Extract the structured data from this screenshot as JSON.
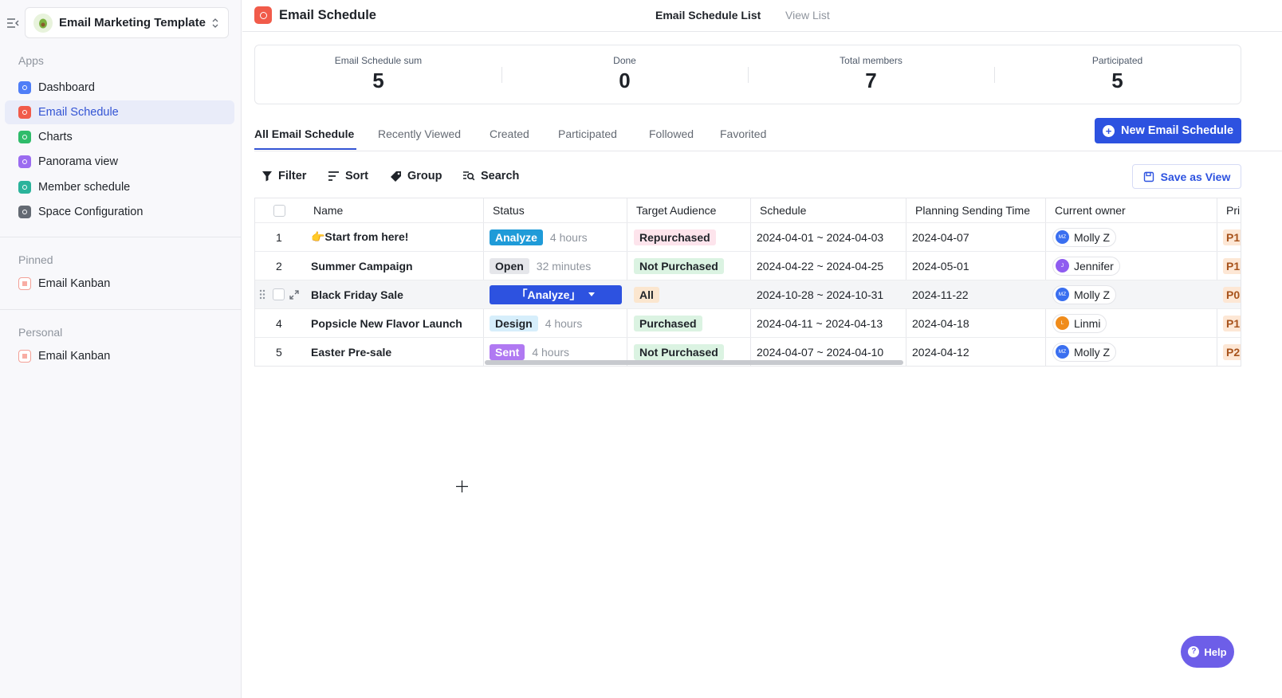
{
  "sidebar": {
    "workspace_name": "Email Marketing Template",
    "sections": {
      "apps": "Apps",
      "pinned": "Pinned",
      "personal": "Personal"
    },
    "apps": [
      {
        "label": "Dashboard",
        "color": "#4f7ef7"
      },
      {
        "label": "Email Schedule",
        "color": "#f15b4a",
        "active": true
      },
      {
        "label": "Charts",
        "color": "#2fbc6a"
      },
      {
        "label": "Panorama view",
        "color": "#9b6cf0"
      },
      {
        "label": "Member schedule",
        "color": "#2bb39b"
      },
      {
        "label": "Space Configuration",
        "color": "#646a73"
      }
    ],
    "pinned": [
      {
        "label": "Email Kanban"
      }
    ],
    "personal": [
      {
        "label": "Email Kanban"
      }
    ]
  },
  "header": {
    "title": "Email Schedule",
    "tabs": [
      "Email Schedule List",
      "View List"
    ]
  },
  "stats": [
    {
      "label": "Email Schedule sum",
      "value": "5"
    },
    {
      "label": "Done",
      "value": "0"
    },
    {
      "label": "Total members",
      "value": "7"
    },
    {
      "label": "Participated",
      "value": "5"
    }
  ],
  "view_tabs": [
    "All Email Schedule",
    "Recently Viewed",
    "Created",
    "Participated",
    "Followed",
    "Favorited"
  ],
  "new_button": "New Email Schedule",
  "toolbar": {
    "filter": "Filter",
    "sort": "Sort",
    "group": "Group",
    "search": "Search",
    "save_view": "Save as View"
  },
  "table": {
    "columns": [
      "Name",
      "Status",
      "Target Audience",
      "Schedule",
      "Planning Sending Time",
      "Current owner",
      "Pri"
    ],
    "rows": [
      {
        "num": "1",
        "name": "👉Start from here!",
        "status": "Analyze",
        "status_color": "#1f9bd8",
        "duration": "4 hours",
        "audience": "Repurchased",
        "audience_bg": "#fde4ec",
        "schedule": "2024-04-01 ~ 2024-04-03",
        "send": "2024-04-07",
        "owner": "Molly Z",
        "initials": "MZ",
        "avatar_color": "#3a6ff0",
        "pri": "P1"
      },
      {
        "num": "2",
        "name": "Summer Campaign",
        "status": "Open",
        "status_color": "#e5e6ea",
        "duration": "32 minutes",
        "audience": "Not Purchased",
        "audience_bg": "#dbf3e2",
        "schedule": "2024-04-22 ~ 2024-04-25",
        "send": "2024-05-01",
        "owner": "Jennifer",
        "initials": "J",
        "avatar_color": "#8f5cf0",
        "pri": "P1"
      },
      {
        "num": "",
        "name": "Black Friday Sale",
        "status": "「Analyze」",
        "status_color": "#2d52e0",
        "duration": "",
        "audience": "All",
        "audience_bg": "#fbe6cf",
        "schedule": "2024-10-28 ~ 2024-10-31",
        "send": "2024-11-22",
        "owner": "Molly Z",
        "initials": "MZ",
        "avatar_color": "#3a6ff0",
        "pri": "P0"
      },
      {
        "num": "4",
        "name": "Popsicle New Flavor Launch",
        "status": "Design",
        "status_color": "#d6eefb",
        "duration": "4 hours",
        "audience": "Purchased",
        "audience_bg": "#dbf3e2",
        "schedule": "2024-04-11 ~ 2024-04-13",
        "send": "2024-04-18",
        "owner": "Linmi",
        "initials": "L",
        "avatar_color": "#f08c1b",
        "pri": "P1"
      },
      {
        "num": "5",
        "name": "Easter Pre-sale",
        "status": "Sent",
        "status_color": "#b079f2",
        "duration": "4 hours",
        "audience": "Not Purchased",
        "audience_bg": "#dbf3e2",
        "schedule": "2024-04-07 ~ 2024-04-10",
        "send": "2024-04-12",
        "owner": "Molly Z",
        "initials": "MZ",
        "avatar_color": "#3a6ff0",
        "pri": "P2"
      }
    ]
  },
  "help": "Help"
}
